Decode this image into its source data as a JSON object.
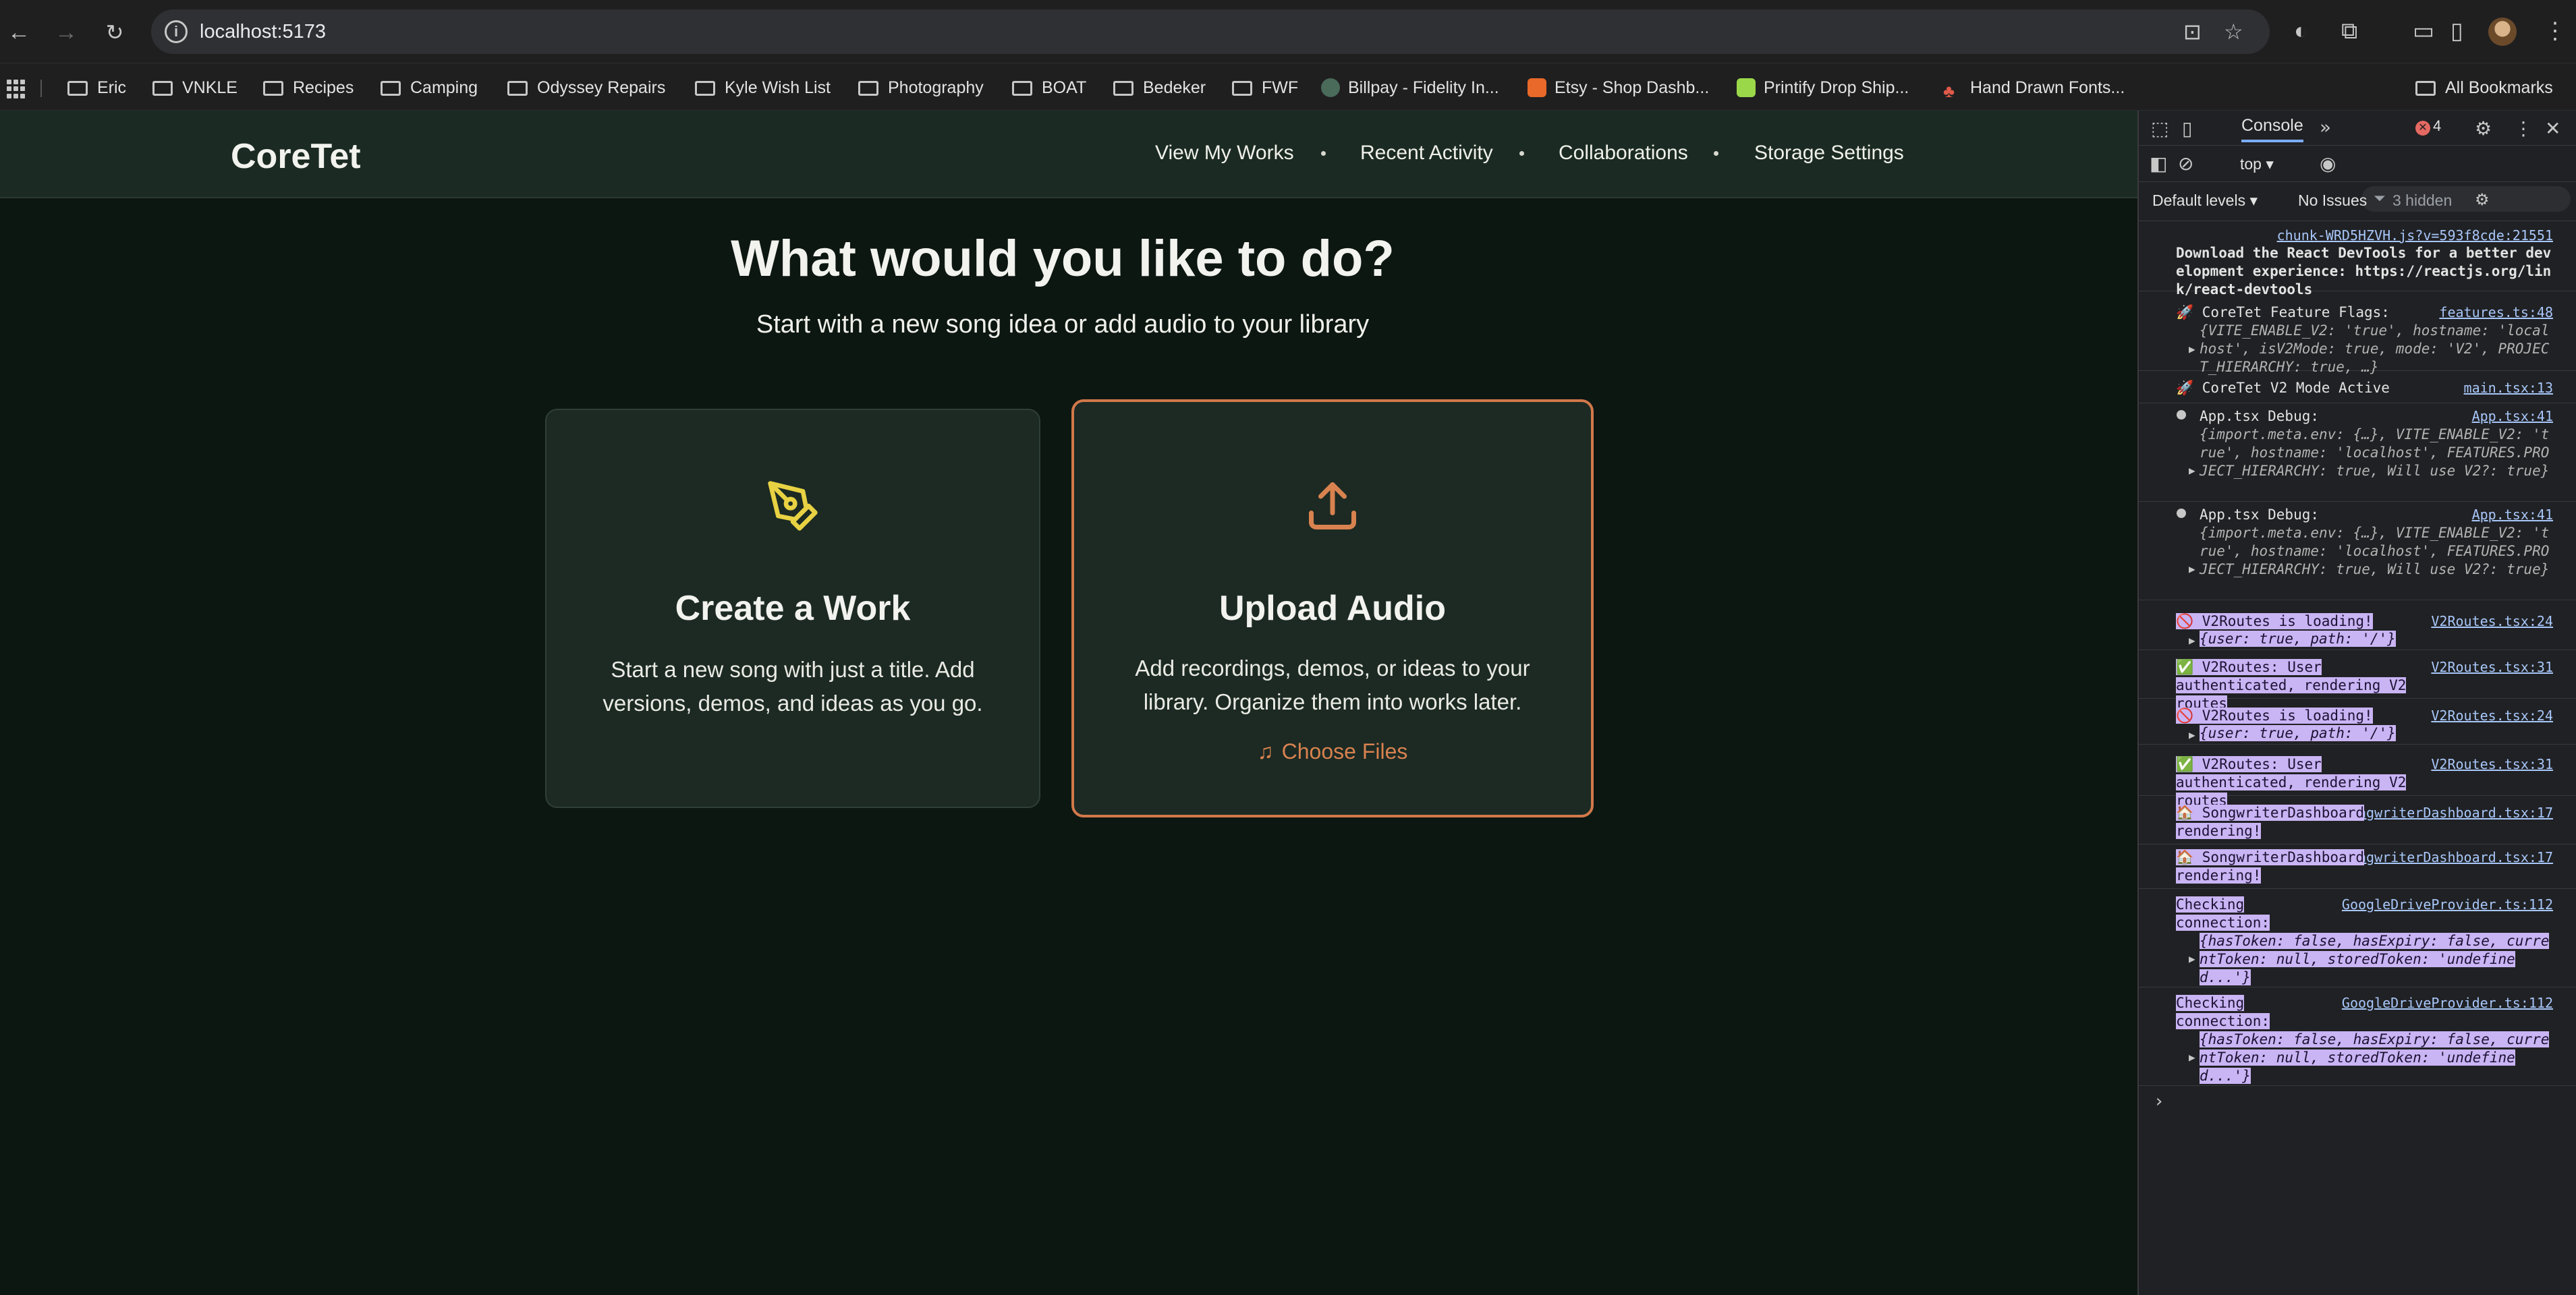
{
  "browser": {
    "url": "localhost:5173",
    "bookmarks": [
      "Eric",
      "VNKLE",
      "Recipes",
      "Camping",
      "Odyssey Repairs",
      "Kyle Wish List",
      "Photography",
      "BOAT",
      "Bedeker",
      "FWF",
      "Billpay - Fidelity In...",
      "Etsy - Shop Dashb...",
      "Printify Drop Ship...",
      "Hand Drawn Fonts..."
    ],
    "all_bookmarks": "All Bookmarks"
  },
  "app": {
    "brand": "CoreTet",
    "nav": [
      "View My Works",
      "Recent Activity",
      "Collaborations",
      "Storage Settings"
    ],
    "headline": "What would you like to do?",
    "subline": "Start with a new song idea or add audio to your library",
    "card_work": {
      "title": "Create a Work",
      "desc": "Start a new song with just a title. Add versions, demos, and ideas as you go."
    },
    "card_upload": {
      "title": "Upload Audio",
      "desc": "Add recordings, demos, or ideas to your library. Organize them into works later.",
      "action": "Choose Files"
    }
  },
  "devtools": {
    "tab": "Console",
    "error_count": "4",
    "context": "top",
    "levels": "Default levels",
    "issues": "No Issues",
    "hidden": "3 hidden",
    "logs": [
      {
        "src": "chunk-WRD5HZVH.js?v=593f8cde:21551",
        "text": "Download the React DevTools for a better development experience: https://reactjs.org/link/react-devtools"
      },
      {
        "src": "features.ts:48",
        "text": "🚀 CoreTet Feature Flags:",
        "detail": "{VITE_ENABLE_V2: 'true', hostname: 'localhost', isV2Mode: true, mode: 'V2', PROJECT_HIERARCHY: true, …}"
      },
      {
        "src": "main.tsx:13",
        "text": "🚀 CoreTet V2 Mode Active"
      },
      {
        "src": "App.tsx:41",
        "text": "App.tsx Debug:",
        "detail": "{import.meta.env: {…}, VITE_ENABLE_V2: 'true', hostname: 'localhost', FEATURES.PROJECT_HIERARCHY: true, Will use V2?: true}"
      },
      {
        "src": "App.tsx:41",
        "text": "App.tsx Debug:",
        "detail": "{import.meta.env: {…}, VITE_ENABLE_V2: 'true', hostname: 'localhost', FEATURES.PROJECT_HIERARCHY: true, Will use V2?: true}"
      },
      {
        "src": "V2Routes.tsx:24",
        "text": "🚫 V2Routes is loading!",
        "detail": "{user: true, path: '/'}"
      },
      {
        "src": "V2Routes.tsx:31",
        "text": "✅ V2Routes: User authenticated, rendering V2 routes"
      },
      {
        "src": "V2Routes.tsx:24",
        "text": "🚫 V2Routes is loading!",
        "detail": "{user: true, path: '/'}"
      },
      {
        "src": "V2Routes.tsx:31",
        "text": "✅ V2Routes: User authenticated, rendering V2 routes"
      },
      {
        "src": "SongwriterDashboard.tsx:17",
        "text": "🏠 SongwriterDashboard rendering!"
      },
      {
        "src": "SongwriterDashboard.tsx:17",
        "text": "🏠 SongwriterDashboard rendering!"
      },
      {
        "src": "GoogleDriveProvider.ts:112",
        "text": "Checking connection:",
        "detail": "{hasToken: false, hasExpiry: false, currentToken: null, storedToken: 'undefined...'}"
      },
      {
        "src": "GoogleDriveProvider.ts:112",
        "text": "Checking connection:",
        "detail": "{hasToken: false, hasExpiry: false, currentToken: null, storedToken: 'undefined...'}"
      }
    ],
    "prompt": "›"
  },
  "colors": {
    "accent_upload": "#d2784a",
    "pen_icon": "#e8d243",
    "app_bg": "#0d1712",
    "header_bg": "#1b2b23",
    "card_bg": "#1c2a23",
    "log_highlight": "#c9b4f4"
  },
  "icons": {
    "work": "pen-nib-icon",
    "upload": "upload-icon",
    "choose": "music-note-icon"
  }
}
